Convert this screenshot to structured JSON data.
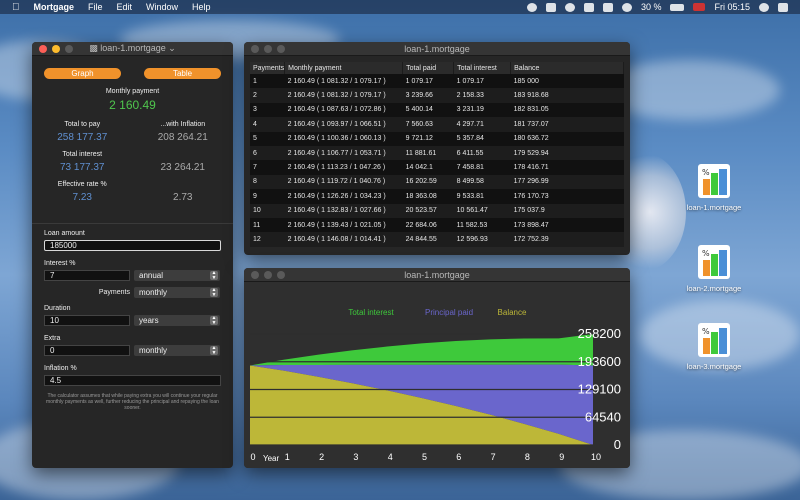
{
  "menubar": {
    "app_name": "Mortgage",
    "menus": [
      "File",
      "Edit",
      "Window",
      "Help"
    ],
    "battery": "30 %",
    "clock": "Fri 05:15"
  },
  "form_window": {
    "title": "loan-1.mortgage",
    "graph_button": "Graph",
    "table_button": "Table",
    "monthly_payment_label": "Monthly payment",
    "monthly_payment_value": "2 160.49",
    "total_to_pay_label": "Total to pay",
    "total_to_pay_value": "258 177.37",
    "with_inflation_label": "...with Inflation",
    "with_inflation_value": "208 264.21",
    "total_interest_label": "Total interest",
    "total_interest_value": "73 177.37",
    "total_interest_inflation_value": "23 264.21",
    "effective_rate_label": "Effective rate %",
    "effective_rate_value": "7.23",
    "effective_rate_inflation_value": "2.73",
    "loan_amount_label": "Loan amount",
    "loan_amount_value": "185000",
    "interest_label": "Interest %",
    "interest_value": "7",
    "interest_period": "annual",
    "payments_label": "Payments",
    "payments_value": "monthly",
    "duration_label": "Duration",
    "duration_value": "10",
    "duration_unit": "years",
    "extra_label": "Extra",
    "extra_value": "0",
    "extra_period": "monthly",
    "inflation_label": "Inflation %",
    "inflation_value": "4.5",
    "note": "The calculator assumes that while paying extra you will continue your regular monthly payments as well, further reducing the principal and repaying the loan sooner."
  },
  "table_window": {
    "title": "loan-1.mortgage",
    "columns": [
      "Payments",
      "Monthly payment",
      "Total paid",
      "Total interest",
      "Balance"
    ],
    "rows": [
      [
        "1",
        "2 160.49 ( 1 081.32 / 1 079.17 )",
        "1 079.17",
        "1 079.17",
        "185 000"
      ],
      [
        "2",
        "2 160.49 ( 1 081.32 / 1 079.17 )",
        "3 239.66",
        "2 158.33",
        "183 918.68"
      ],
      [
        "3",
        "2 160.49 ( 1 087.63 / 1 072.86 )",
        "5 400.14",
        "3 231.19",
        "182 831.05"
      ],
      [
        "4",
        "2 160.49 ( 1 093.97 / 1 066.51 )",
        "7 560.63",
        "4 297.71",
        "181 737.07"
      ],
      [
        "5",
        "2 160.49 ( 1 100.36 / 1 060.13 )",
        "9 721.12",
        "5 357.84",
        "180 636.72"
      ],
      [
        "6",
        "2 160.49 ( 1 106.77 / 1 053.71 )",
        "11 881.61",
        "6 411.55",
        "179 529.94"
      ],
      [
        "7",
        "2 160.49 ( 1 113.23 / 1 047.26 )",
        "14 042.1",
        "7 458.81",
        "178 416.71"
      ],
      [
        "8",
        "2 160.49 ( 1 119.72 / 1 040.76 )",
        "16 202.59",
        "8 499.58",
        "177 296.99"
      ],
      [
        "9",
        "2 160.49 ( 1 126.26 / 1 034.23 )",
        "18 363.08",
        "9 533.81",
        "176 170.73"
      ],
      [
        "10",
        "2 160.49 ( 1 132.83 / 1 027.66 )",
        "20 523.57",
        "10 561.47",
        "175 037.9"
      ],
      [
        "11",
        "2 160.49 ( 1 139.43 / 1 021.05 )",
        "22 684.06",
        "11 582.53",
        "173 898.47"
      ],
      [
        "12",
        "2 160.49 ( 1 146.08 / 1 014.41 )",
        "24 844.55",
        "12 596.93",
        "172 752.39"
      ]
    ]
  },
  "chart_window": {
    "title": "loan-1.mortgage"
  },
  "chart_data": {
    "type": "area",
    "x": [
      0,
      1,
      2,
      3,
      4,
      5,
      6,
      7,
      8,
      9,
      10
    ],
    "xlabel": "Year",
    "ylim": [
      0,
      258200
    ],
    "y_ticks": [
      "258200",
      "193600",
      "129100",
      "64540",
      "0"
    ],
    "series": [
      {
        "name": "Total interest",
        "color": "#3ec93b",
        "values": [
          0,
          12597,
          23960,
          34010,
          42650,
          49780,
          55290,
          59070,
          60980,
          61120,
          73177
        ]
      },
      {
        "name": "Principal paid",
        "color": "#6a66cc",
        "values": [
          0,
          13328,
          27620,
          42950,
          59390,
          77010,
          95910,
          116170,
          137900,
          161190,
          185000
        ]
      },
      {
        "name": "Balance",
        "color": "#bdb738",
        "values": [
          185000,
          172752,
          158540,
          143310,
          126970,
          109460,
          90680,
          70540,
          48950,
          25800,
          0
        ]
      }
    ]
  },
  "desktop_icons": [
    "loan-1.mortgage",
    "loan-2.mortgage",
    "loan-3.mortgage"
  ]
}
